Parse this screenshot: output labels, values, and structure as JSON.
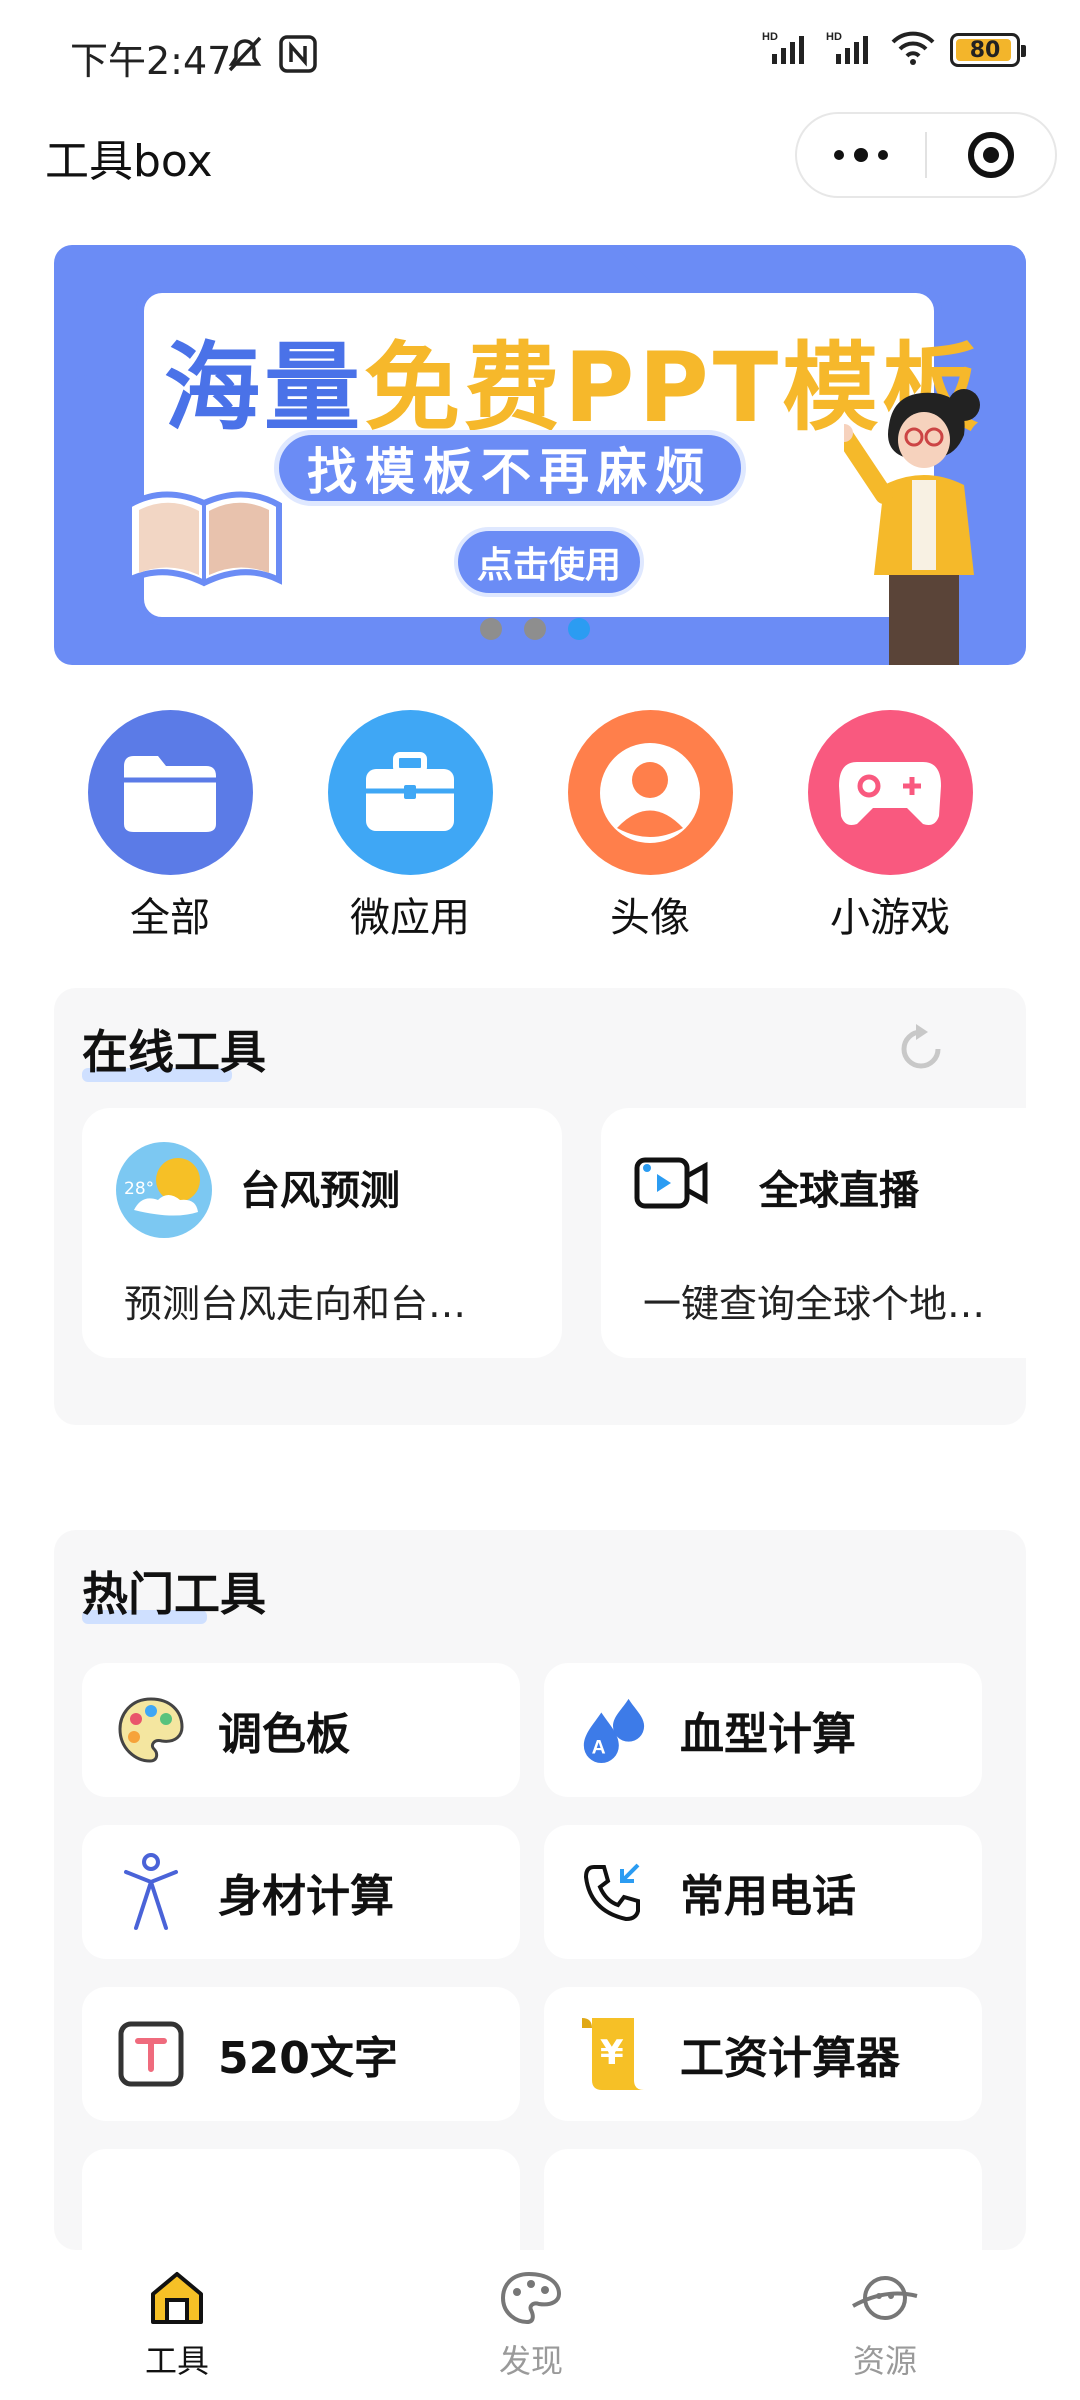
{
  "status_bar": {
    "time": "下午2:47",
    "battery": "80"
  },
  "header": {
    "title": "工具box"
  },
  "banner": {
    "headline_part1": "海量",
    "headline_part2": "免费PPT模板",
    "subtitle": "找模板不再麻烦",
    "cta": "点击使用",
    "dots_total": 3,
    "active_dot": 3
  },
  "categories": [
    {
      "label": "全部",
      "color": "#5b7be7",
      "icon": "folder-icon"
    },
    {
      "label": "微应用",
      "color": "#3fa7f5",
      "icon": "briefcase-icon"
    },
    {
      "label": "头像",
      "color": "#ff7f4b",
      "icon": "user-avatar-icon"
    },
    {
      "label": "小游戏",
      "color": "#f9597f",
      "icon": "gamepad-icon"
    }
  ],
  "online_tools": {
    "title": "在线工具",
    "cards": [
      {
        "name": "台风预测",
        "desc": "预测台风走向和台…",
        "icon": "typhoon-weather-icon",
        "temp": "28°"
      },
      {
        "name": "全球直播",
        "desc": "一键查询全球个地…",
        "icon": "live-camera-icon"
      }
    ]
  },
  "hot_tools": {
    "title": "热门工具",
    "items": [
      {
        "name": "调色板",
        "icon": "palette-icon"
      },
      {
        "name": "血型计算",
        "icon": "blood-drop-icon"
      },
      {
        "name": "身材计算",
        "icon": "body-figure-icon"
      },
      {
        "name": "常用电话",
        "icon": "phone-call-icon"
      },
      {
        "name": "520文字",
        "icon": "text-t-icon"
      },
      {
        "name": "工资计算器",
        "icon": "yen-scroll-icon"
      }
    ]
  },
  "tabbar": {
    "tabs": [
      {
        "label": "工具",
        "icon": "home-icon",
        "active": true
      },
      {
        "label": "发现",
        "icon": "palette-discover-icon",
        "active": false
      },
      {
        "label": "资源",
        "icon": "planet-icon",
        "active": false
      }
    ],
    "active_color": "#111111",
    "inactive_color": "#9a9a9a"
  }
}
